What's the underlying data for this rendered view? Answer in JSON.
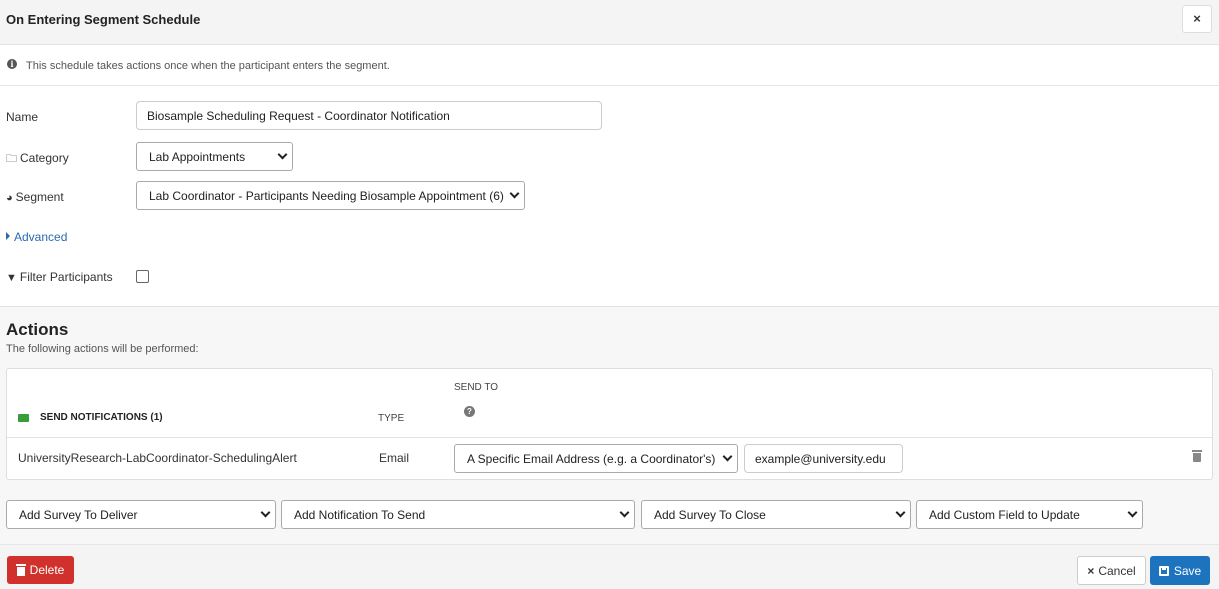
{
  "modal": {
    "title": "On Entering Segment Schedule",
    "close_glyph": "×",
    "info_text": "This schedule takes actions once when the participant enters the segment."
  },
  "form": {
    "name_label": "Name",
    "name_value": "Biosample Scheduling Request - Coordinator Notification",
    "category_label": "Category",
    "category_value": "Lab Appointments",
    "segment_label": "Segment",
    "segment_value": "Lab Coordinator - Participants Needing Biosample Appointment (6)",
    "advanced_label": "Advanced",
    "filter_label": "Filter Participants",
    "filter_checked": false
  },
  "actions": {
    "title": "Actions",
    "subtitle": "The following actions will be performed:",
    "table": {
      "section_header": "SEND NOTIFICATIONS (1)",
      "type_header": "TYPE",
      "send_to_header": "SEND TO",
      "rows": [
        {
          "name": "UniversityResearch-LabCoordinator-SchedulingAlert",
          "type": "Email",
          "send_to": "A Specific Email Address (e.g. a Coordinator's)",
          "email": "example@university.edu"
        }
      ]
    },
    "add_selects": [
      "Add Survey To Deliver",
      "Add Notification To Send",
      "Add Survey To Close",
      "Add Custom Field to Update"
    ]
  },
  "footer": {
    "delete_label": "Delete",
    "cancel_label": "Cancel",
    "save_label": "Save"
  },
  "icons": {
    "info": "info-circle-icon",
    "category": "folder-icon",
    "segment": "pie-chart-icon",
    "filter": "filter-icon",
    "notification": "envelope-icon",
    "help": "question-circle-icon",
    "delete_row": "trash-icon"
  },
  "colors": {
    "link": "#2a6ab0",
    "delete": "#d0312d",
    "save": "#1e73be",
    "envelope": "#3a9d3a"
  }
}
